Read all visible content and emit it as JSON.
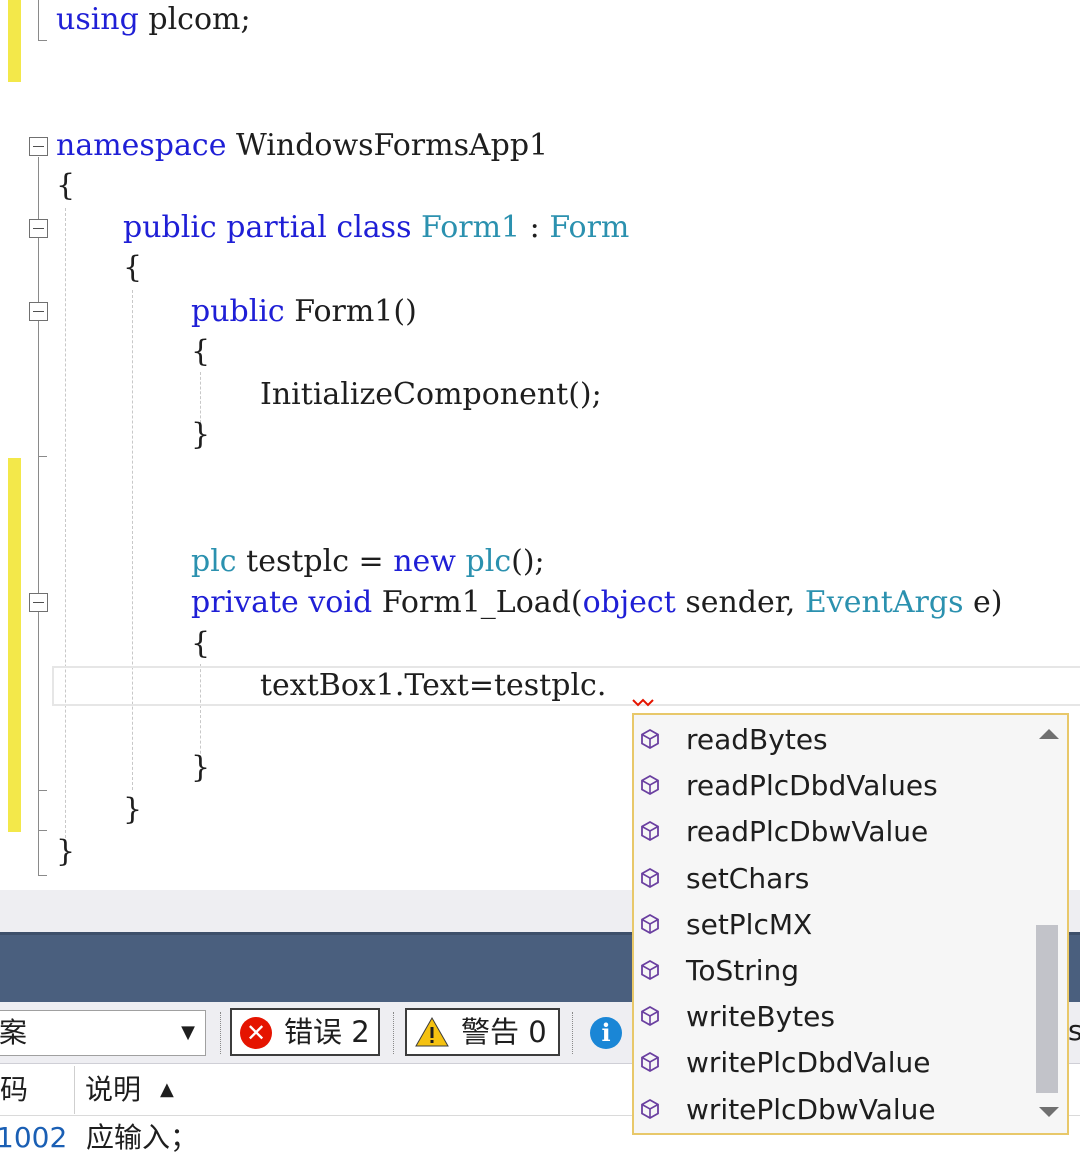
{
  "editor": {
    "lines": {
      "using": [
        "using",
        " plcom;"
      ],
      "namespace": [
        "namespace",
        " WindowsFormsApp1"
      ],
      "ns_open": "{",
      "class_decl": [
        "public",
        " ",
        "partial",
        " ",
        "class",
        " ",
        "Form1",
        " : ",
        "Form"
      ],
      "class_open": "{",
      "ctor_decl": [
        "public",
        " Form1()"
      ],
      "ctor_open": "{",
      "ctor_body": "InitializeComponent();",
      "ctor_close": "}",
      "field": [
        "plc",
        " testplc = ",
        "new",
        " ",
        "plc",
        "();"
      ],
      "load_decl": [
        "private",
        " ",
        "void",
        " Form1_Load(",
        "object",
        " sender, ",
        "EventArgs",
        " e)"
      ],
      "load_open": "{",
      "load_body": "textBox1.Text=testplc.",
      "load_close": "}",
      "class_close": "}",
      "ns_close": "}"
    }
  },
  "completion": {
    "icon": "method-cube-icon",
    "items": [
      "readBytes",
      "readPlcDbdValues",
      "readPlcDbwValue",
      "setChars",
      "setPlcMX",
      "ToString",
      "writeBytes",
      "writePlcDbdValue",
      "writePlcDbwValue"
    ]
  },
  "error_list": {
    "scope_combo": "案",
    "errors_label": "错误 2",
    "warnings_label": "警告 0",
    "trailing_text": "s",
    "columns": {
      "code": "码",
      "description": "说明"
    },
    "first_row": {
      "code": "1002",
      "description": "应输入；"
    }
  },
  "colors": {
    "keyword": "#1f1fd6",
    "type": "#2b91af",
    "change_marker": "#f3e84a",
    "panel_title": "#4a5f7e",
    "error": "#e51400",
    "popup_border": "#e8c86a"
  }
}
